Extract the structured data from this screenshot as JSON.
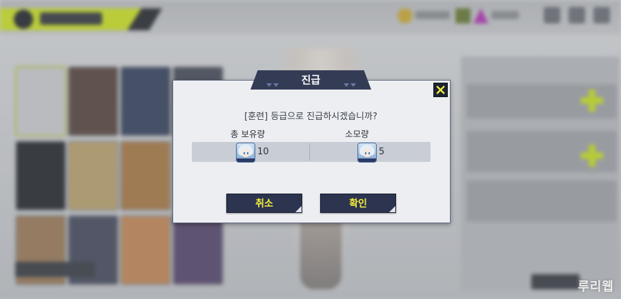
{
  "dialog": {
    "title": "진급",
    "question": "[훈련] 등급으로 진급하시겠습니까?",
    "owned_label": "총 보유량",
    "owned_value": "10",
    "cost_label": "소모량",
    "cost_value": "5",
    "item_icon": "character-portrait-icon",
    "close_icon": "close-icon"
  },
  "buttons": {
    "cancel": "취소",
    "confirm": "확인"
  },
  "watermark": "루리웹",
  "colors": {
    "dialog_bg": "#eceef1",
    "header_bg": "#343c55",
    "button_bg": "#2c3450",
    "button_text": "#f3ee3a",
    "accent_lime": "#c8dd2a"
  }
}
